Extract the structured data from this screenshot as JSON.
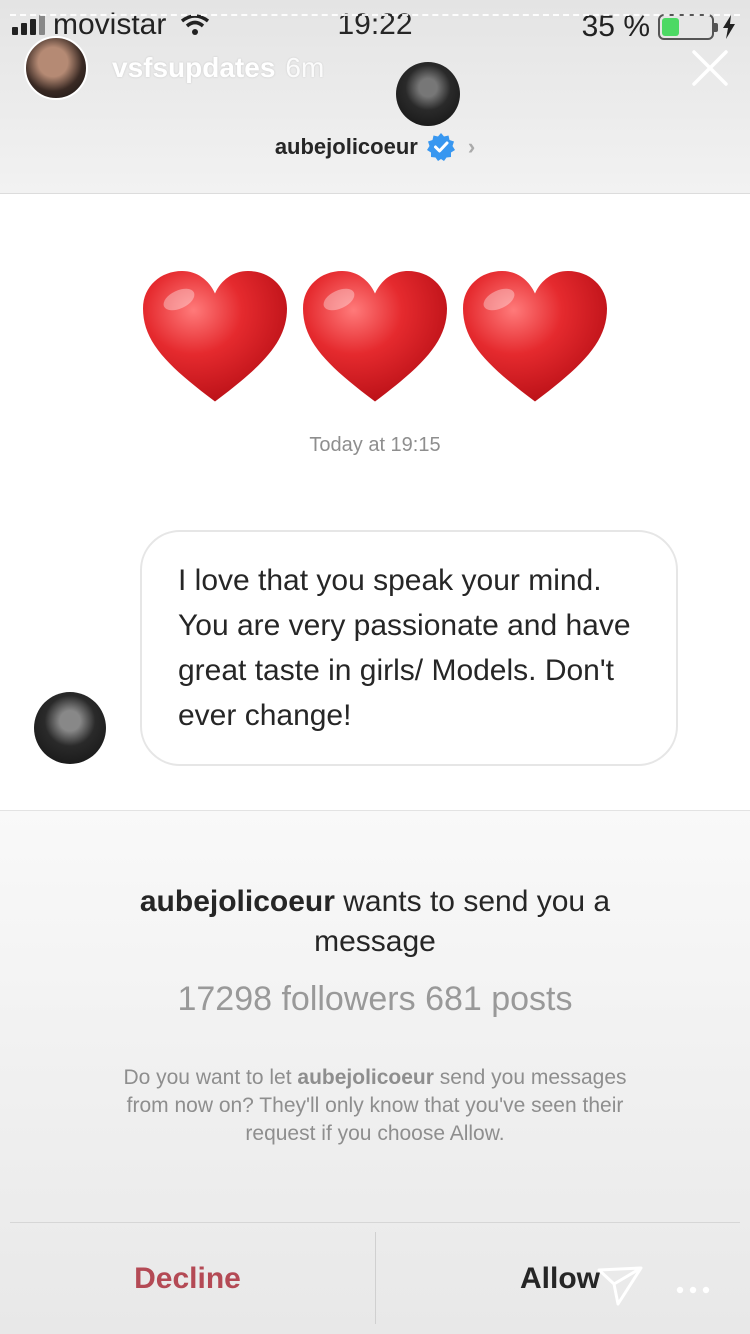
{
  "status_bar": {
    "carrier": "movistar",
    "time": "19:22",
    "battery": "35 %",
    "battery_level": 0.35
  },
  "story": {
    "username": "vsfsupdates",
    "age": "6m"
  },
  "profile": {
    "username": "aubejolicoeur",
    "verified": true
  },
  "message": {
    "hearts": [
      "❤️",
      "❤️",
      "❤️"
    ],
    "timestamp": "Today at 19:15",
    "text": "I love that you speak your mind. You are very passionate and have great taste in girls/ Models. Don't ever change!"
  },
  "request": {
    "username": "aubejolicoeur",
    "title_suffix": "wants to send you a message",
    "stats": "17298 followers 681 posts",
    "desc_prefix": "Do you want to let",
    "desc_username": "aubejolicoeur",
    "desc_suffix": "send you messages from now on? They'll only know that you've seen their request if you choose Allow."
  },
  "actions": {
    "decline": "Decline",
    "allow": "Allow"
  },
  "colors": {
    "decline": "#b44a55",
    "verified": "#3897f0",
    "heart": "#e0242a"
  },
  "icons": [
    "signal-icon",
    "wifi-icon",
    "battery-icon",
    "charging-icon",
    "close-icon",
    "verified-icon",
    "chevron-right-icon",
    "heart-icon",
    "send-icon",
    "more-icon"
  ]
}
